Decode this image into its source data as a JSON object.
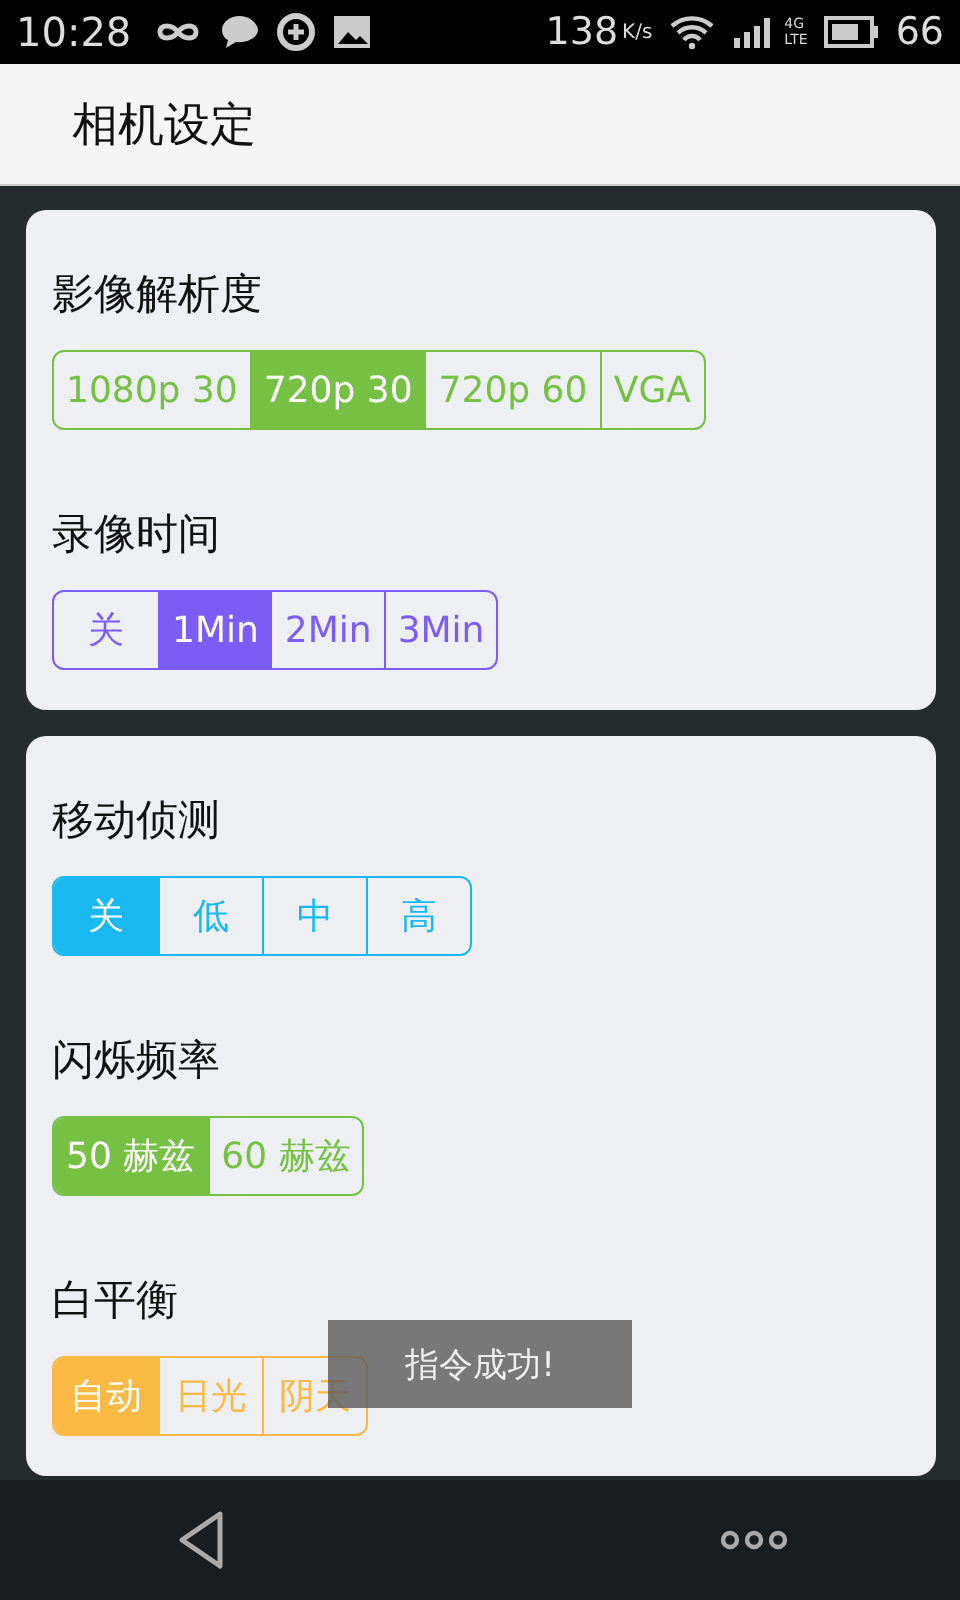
{
  "status_bar": {
    "time": "10:28",
    "speed": "138",
    "speed_unit": "K/s",
    "network": "4G",
    "network_sub": "LTE",
    "battery": "66"
  },
  "title": "相机设定",
  "cards": [
    {
      "groups": [
        {
          "label": "影像解析度",
          "color": "#76c043",
          "options": [
            {
              "text": "1080p 30",
              "selected": false
            },
            {
              "text": "720p 30",
              "selected": true
            },
            {
              "text": "720p 60",
              "selected": false
            },
            {
              "text": "VGA",
              "selected": false
            }
          ]
        },
        {
          "label": "录像时间",
          "color": "#7b5cf5",
          "options": [
            {
              "text": "关",
              "selected": false
            },
            {
              "text": "1Min",
              "selected": true
            },
            {
              "text": "2Min",
              "selected": false
            },
            {
              "text": "3Min",
              "selected": false
            }
          ]
        }
      ]
    },
    {
      "groups": [
        {
          "label": "移动侦测",
          "color": "#19b8f0",
          "options": [
            {
              "text": "关",
              "selected": true
            },
            {
              "text": "低",
              "selected": false
            },
            {
              "text": "中",
              "selected": false
            },
            {
              "text": "高",
              "selected": false
            }
          ]
        },
        {
          "label": "闪烁频率",
          "color": "#76c043",
          "options": [
            {
              "text": "50 赫兹",
              "selected": true
            },
            {
              "text": "60 赫兹",
              "selected": false
            }
          ]
        },
        {
          "label": "白平衡",
          "color": "#f9b944",
          "options": [
            {
              "text": "自动",
              "selected": true
            },
            {
              "text": "日光",
              "selected": false
            },
            {
              "text": "阴天",
              "selected": false
            }
          ]
        }
      ]
    }
  ],
  "toast": "指令成功!"
}
